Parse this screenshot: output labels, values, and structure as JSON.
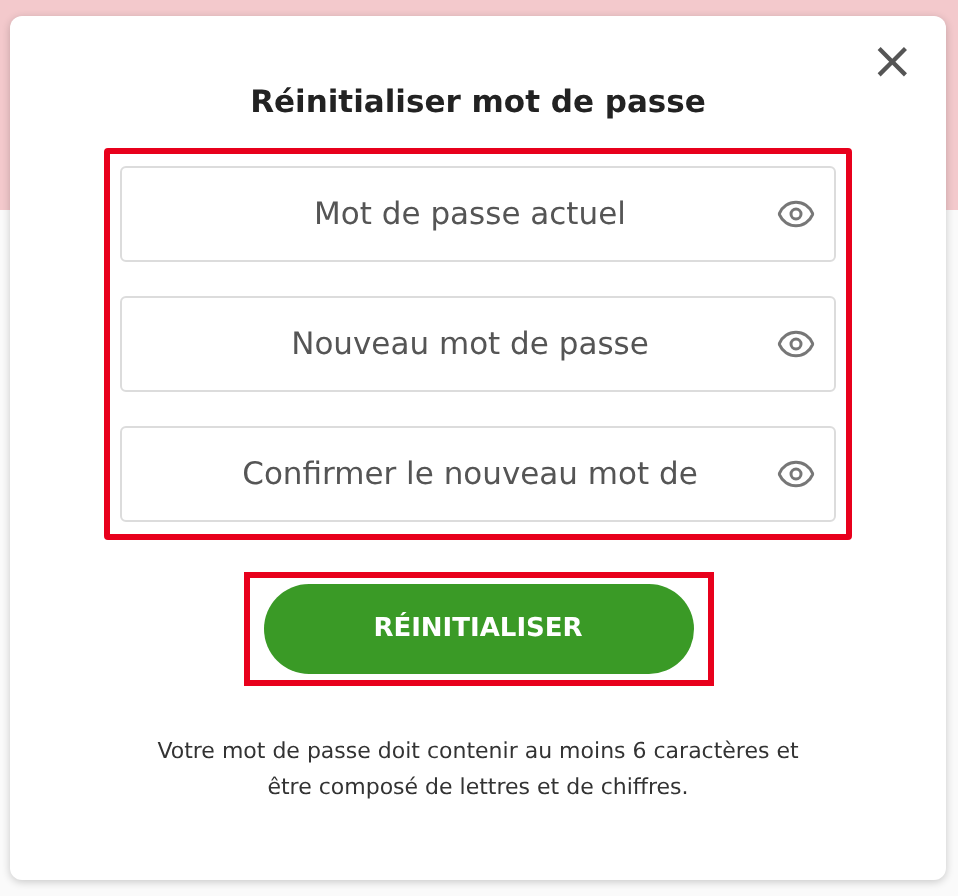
{
  "dialog": {
    "title": "Réinitialiser mot de passe",
    "close": "×",
    "fields": [
      {
        "placeholder": "Mot de passe actuel"
      },
      {
        "placeholder": "Nouveau mot de passe"
      },
      {
        "placeholder": "Confirmer le nouveau mot de"
      }
    ],
    "button": "RÉINITIALISER",
    "note": "Votre mot de passe doit contenir au moins 6 caractères et être composé de lettres et de chiffres."
  }
}
